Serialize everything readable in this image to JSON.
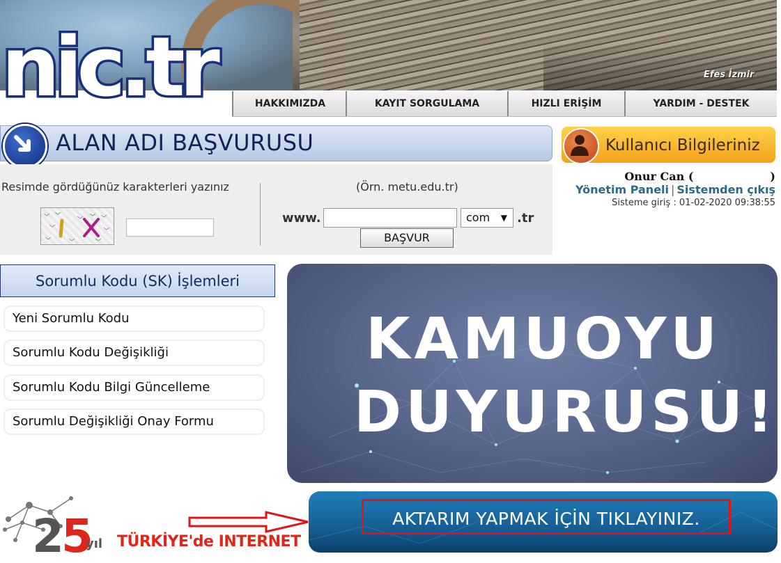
{
  "header": {
    "logo_text": "nic.tr",
    "banner_caption": "Efes İzmir"
  },
  "nav": {
    "items": [
      {
        "label": "HAKKIMIZDA"
      },
      {
        "label": "KAYIT SORGULAMA"
      },
      {
        "label": "HIZLI ERİŞİM"
      },
      {
        "label": "YARDIM - DESTEK"
      }
    ]
  },
  "domain_application": {
    "title": "ALAN ADI BAŞVURUSU",
    "captcha_label": "Resimde gördüğünüz karakterleri yazınız",
    "captcha_input_value": "",
    "example_text": "(Örn. metu.edu.tr)",
    "www_label": "www.",
    "domain_input_value": "",
    "tld_selected": "com",
    "tld_suffix": ".tr",
    "apply_button": "BAŞVUR"
  },
  "user_info": {
    "title": "Kullanıcı Bilgileriniz",
    "user_name": "Onur Can (",
    "user_name_close": ")",
    "panel_link": "Yönetim Paneli",
    "separator": "|",
    "logout_link": "Sistemden çıkış",
    "login_info": "Sisteme giriş : 01-02-2020 09:38:55"
  },
  "sk_menu": {
    "title": "Sorumlu Kodu (SK) İşlemleri",
    "items": [
      {
        "label": "Yeni Sorumlu Kodu"
      },
      {
        "label": "Sorumlu Kodu Değişikliği"
      },
      {
        "label": "Sorumlu Kodu Bilgi Güncelleme"
      },
      {
        "label": "Sorumlu Değişikliği Onay Formu"
      }
    ]
  },
  "announcement": {
    "line1": "KAMUOYU",
    "line2": "DUYURUSU!"
  },
  "internet_logo": {
    "number_2": "2",
    "number_5": "5",
    "yil": "yıl",
    "turkiye": "TÜRKİYE'de INTERNET"
  },
  "transfer_banner": {
    "text": "AKTARIM YAPMAK İÇİN TIKLAYINIZ."
  },
  "colors": {
    "nav_border": "#888888",
    "aab_title": "#13235a",
    "user_link": "#2a6a8a",
    "highlight_red": "#e01515",
    "kamuoyu_bg": "#56648a",
    "transfer_bg": "#165e93"
  }
}
